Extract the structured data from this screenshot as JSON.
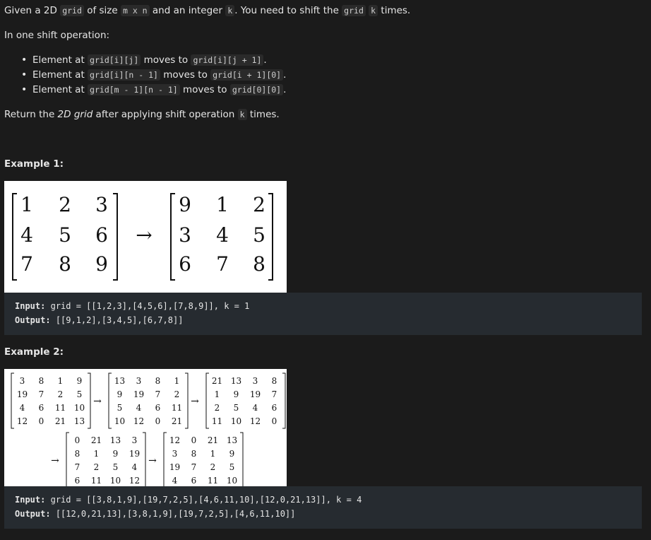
{
  "description": {
    "p1": [
      "Given a 2D ",
      "grid",
      " of size ",
      "m x n",
      " and an integer ",
      "k",
      ". You need to shift the ",
      "grid",
      " ",
      "k",
      " times."
    ],
    "p2": "In one shift operation:",
    "bullets": [
      [
        "Element at ",
        "grid[i][j]",
        " moves to ",
        "grid[i][j + 1]",
        "."
      ],
      [
        "Element at ",
        "grid[i][n - 1]",
        " moves to ",
        "grid[i + 1][0]",
        "."
      ],
      [
        "Element at ",
        "grid[m - 1][n - 1]",
        " moves to ",
        "grid[0][0]",
        "."
      ]
    ],
    "p3": [
      "Return the ",
      "2D grid",
      " after applying shift operation ",
      "k",
      " times."
    ]
  },
  "examples": [
    {
      "heading": "Example 1:",
      "matrices": [
        [
          [
            1,
            2,
            3
          ],
          [
            4,
            5,
            6
          ],
          [
            7,
            8,
            9
          ]
        ],
        [
          [
            9,
            1,
            2
          ],
          [
            3,
            4,
            5
          ],
          [
            6,
            7,
            8
          ]
        ]
      ],
      "arrow": "→",
      "input_label": "Input:",
      "input_value": "grid = [[1,2,3],[4,5,6],[7,8,9]], k = 1",
      "output_label": "Output:",
      "output_value": "[[9,1,2],[3,4,5],[6,7,8]]"
    },
    {
      "heading": "Example 2:",
      "matrices": [
        [
          [
            3,
            8,
            1,
            9
          ],
          [
            19,
            7,
            2,
            5
          ],
          [
            4,
            6,
            11,
            10
          ],
          [
            12,
            0,
            21,
            13
          ]
        ],
        [
          [
            13,
            3,
            8,
            1
          ],
          [
            9,
            19,
            7,
            2
          ],
          [
            5,
            4,
            6,
            11
          ],
          [
            10,
            12,
            0,
            21
          ]
        ],
        [
          [
            21,
            13,
            3,
            8
          ],
          [
            1,
            9,
            19,
            7
          ],
          [
            2,
            5,
            4,
            6
          ],
          [
            11,
            10,
            12,
            0
          ]
        ],
        [
          [
            0,
            21,
            13,
            3
          ],
          [
            8,
            1,
            9,
            19
          ],
          [
            7,
            2,
            5,
            4
          ],
          [
            6,
            11,
            10,
            12
          ]
        ],
        [
          [
            12,
            0,
            21,
            13
          ],
          [
            3,
            8,
            1,
            9
          ],
          [
            19,
            7,
            2,
            5
          ],
          [
            4,
            6,
            11,
            10
          ]
        ]
      ],
      "arrow": "→",
      "input_label": "Input:",
      "input_value": "grid = [[3,8,1,9],[19,7,2,5],[4,6,11,10],[12,0,21,13]], k = 4",
      "output_label": "Output:",
      "output_value": "[[12,0,21,13],[3,8,1,9],[19,7,2,5],[4,6,11,10]]"
    }
  ]
}
